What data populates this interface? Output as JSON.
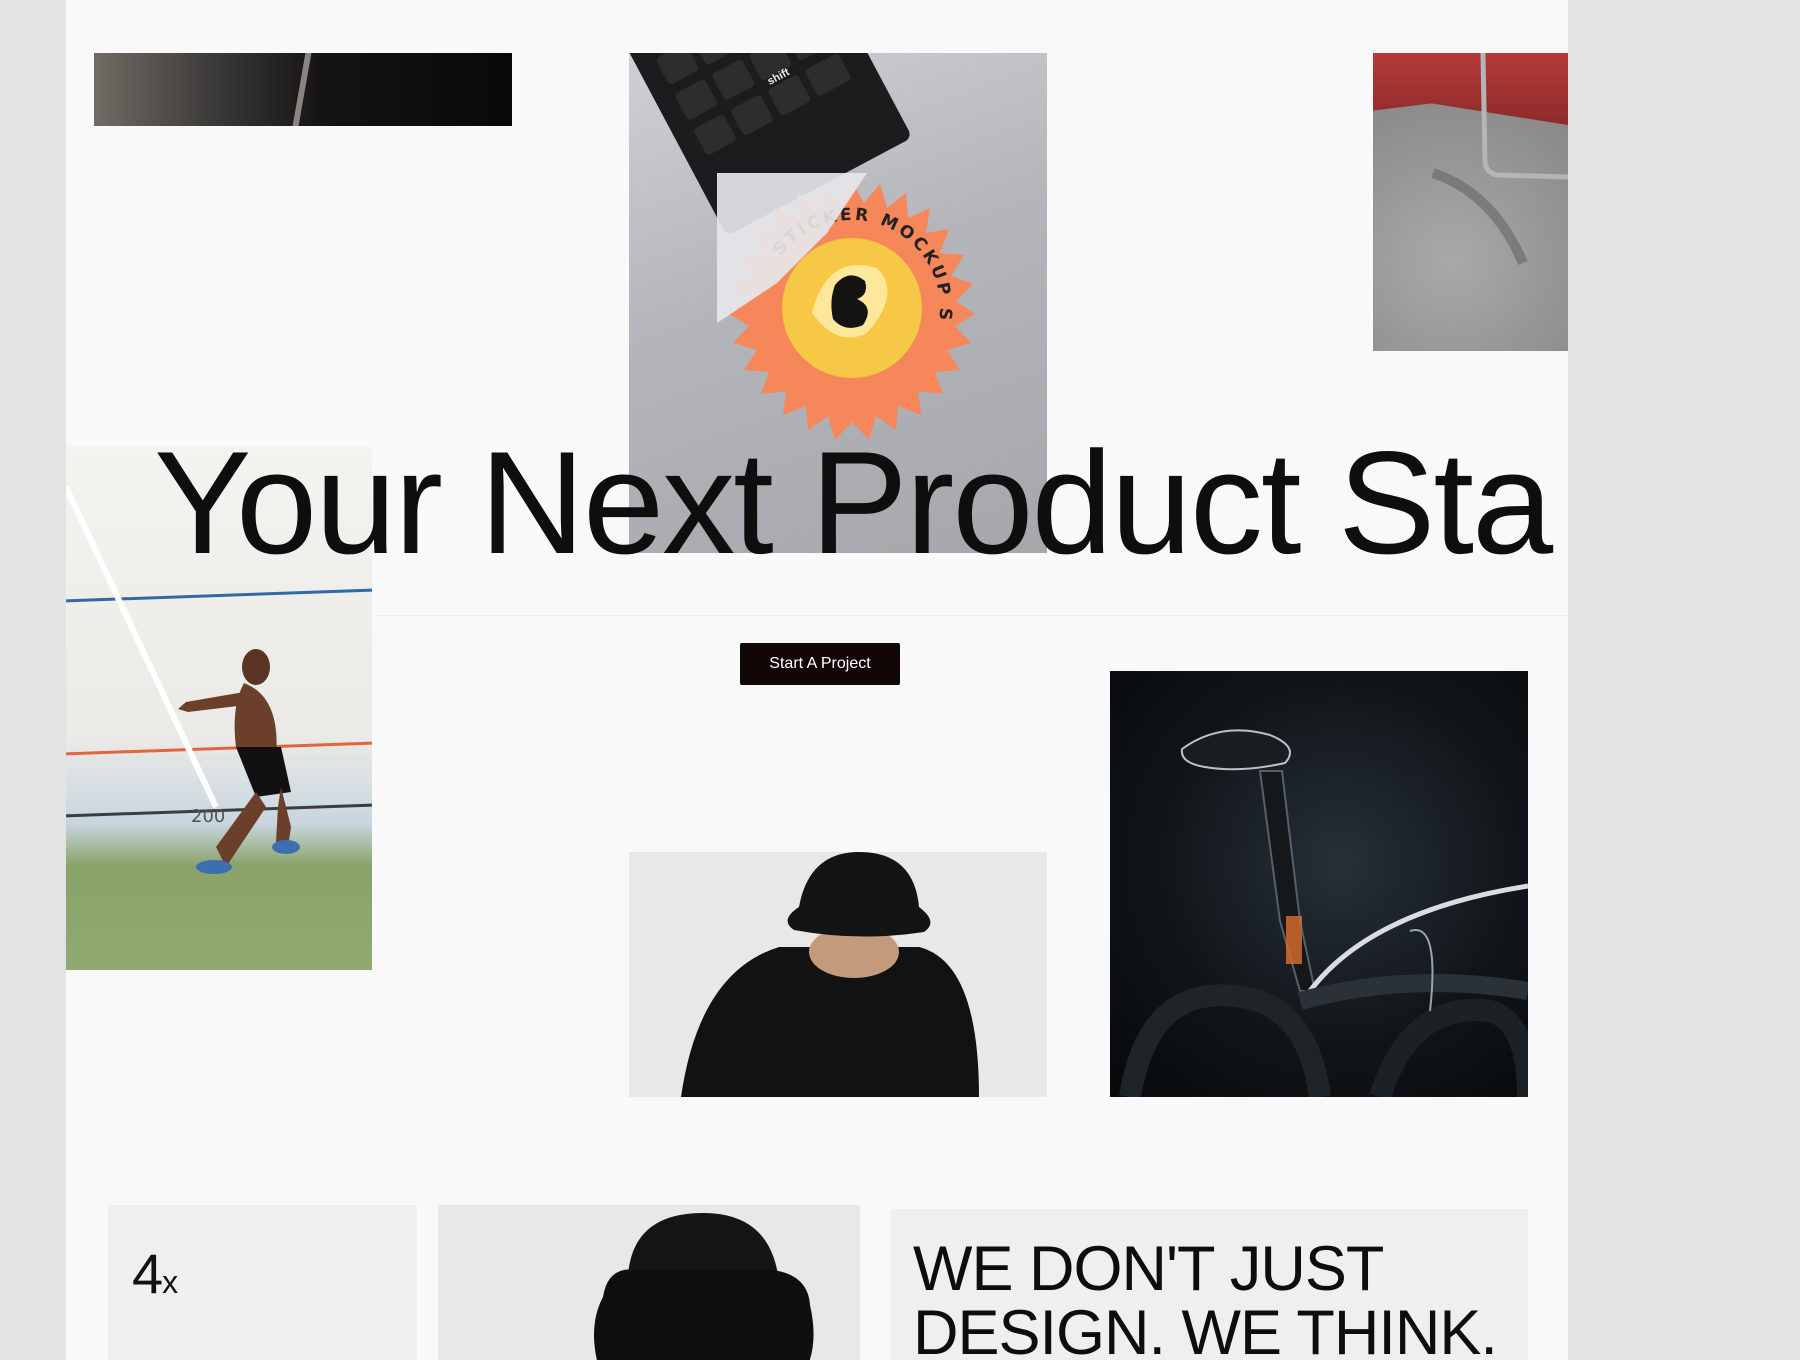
{
  "hero": {
    "headline": "Your Next Product Sta",
    "cta_label": "Start A Project"
  },
  "media": {
    "laptop_key_label": "shift",
    "sticker_text": "STICKER MOCKUP S",
    "runner_track_marking": "200"
  },
  "cards": {
    "stat_value": "4",
    "stat_unit": "x",
    "quote_line_1": "WE DON'T JUST",
    "quote_line_2": "DESIGN. WE THINK."
  },
  "colors": {
    "page_background": "#f9f9f9",
    "cta_background": "#120707",
    "sticker_orange": "#f5875a",
    "sticker_yellow": "#f7c845"
  }
}
